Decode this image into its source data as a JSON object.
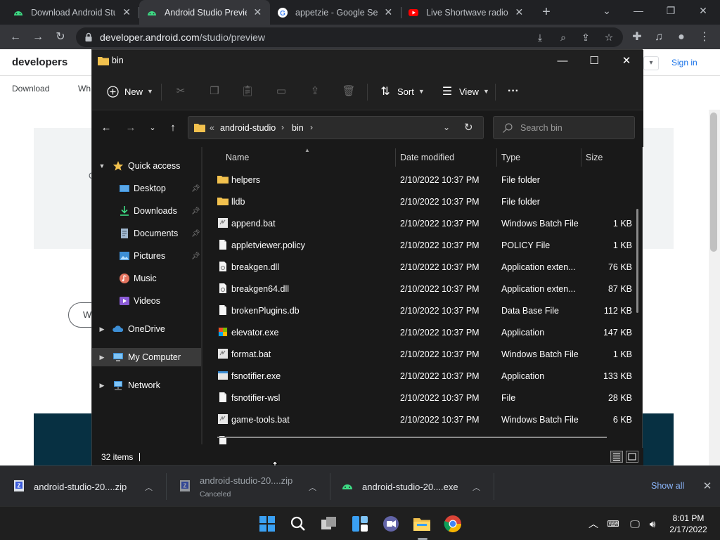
{
  "browser": {
    "tabs": [
      {
        "title": "Download Android Stu",
        "icon": "android-icon",
        "active": false
      },
      {
        "title": "Android Studio Preview",
        "icon": "android-icon",
        "active": true
      },
      {
        "title": "appetzie - Google Sea",
        "icon": "google-icon",
        "active": false
      },
      {
        "title": "Live Shortwave radio s",
        "icon": "youtube-icon",
        "active": false
      }
    ],
    "url_host": "developer.android.com",
    "url_path": "/studio/preview"
  },
  "webpage": {
    "logo": "developers",
    "nav_download": "Download",
    "nav_partial": "Wh",
    "signin": "Sign in",
    "pill_text": "W",
    "side_c": "C"
  },
  "explorer": {
    "title": "bin",
    "commands": {
      "new": "New",
      "sort": "Sort",
      "view": "View",
      "more": "···"
    },
    "path": {
      "overflow": "«",
      "segments": [
        "android-studio",
        "bin"
      ]
    },
    "search_placeholder": "Search bin",
    "sidebar": {
      "quick_access": "Quick access",
      "items": [
        {
          "label": "Desktop",
          "pinned": true
        },
        {
          "label": "Downloads",
          "pinned": true
        },
        {
          "label": "Documents",
          "pinned": true
        },
        {
          "label": "Pictures",
          "pinned": true
        },
        {
          "label": "Music",
          "pinned": false
        },
        {
          "label": "Videos",
          "pinned": false
        }
      ],
      "onedrive": "OneDrive",
      "my_computer": "My Computer",
      "network": "Network"
    },
    "columns": {
      "name": "Name",
      "date": "Date modified",
      "type": "Type",
      "size": "Size"
    },
    "files": [
      {
        "name": "helpers",
        "date": "2/10/2022 10:37 PM",
        "type": "File folder",
        "size": "",
        "icon": "folder"
      },
      {
        "name": "lldb",
        "date": "2/10/2022 10:37 PM",
        "type": "File folder",
        "size": "",
        "icon": "folder"
      },
      {
        "name": "append.bat",
        "date": "2/10/2022 10:37 PM",
        "type": "Windows Batch File",
        "size": "1 KB",
        "icon": "bat"
      },
      {
        "name": "appletviewer.policy",
        "date": "2/10/2022 10:37 PM",
        "type": "POLICY File",
        "size": "1 KB",
        "icon": "file"
      },
      {
        "name": "breakgen.dll",
        "date": "2/10/2022 10:37 PM",
        "type": "Application exten...",
        "size": "76 KB",
        "icon": "dll"
      },
      {
        "name": "breakgen64.dll",
        "date": "2/10/2022 10:37 PM",
        "type": "Application exten...",
        "size": "87 KB",
        "icon": "dll"
      },
      {
        "name": "brokenPlugins.db",
        "date": "2/10/2022 10:37 PM",
        "type": "Data Base File",
        "size": "112 KB",
        "icon": "file"
      },
      {
        "name": "elevator.exe",
        "date": "2/10/2022 10:37 PM",
        "type": "Application",
        "size": "147 KB",
        "icon": "exe-color"
      },
      {
        "name": "format.bat",
        "date": "2/10/2022 10:37 PM",
        "type": "Windows Batch File",
        "size": "1 KB",
        "icon": "bat"
      },
      {
        "name": "fsnotifier.exe",
        "date": "2/10/2022 10:37 PM",
        "type": "Application",
        "size": "133 KB",
        "icon": "exe"
      },
      {
        "name": "fsnotifier-wsl",
        "date": "2/10/2022 10:37 PM",
        "type": "File",
        "size": "28 KB",
        "icon": "file"
      },
      {
        "name": "game-tools.bat",
        "date": "2/10/2022 10:37 PM",
        "type": "Windows Batch File",
        "size": "6 KB",
        "icon": "bat"
      }
    ],
    "status": "32 items"
  },
  "downloads": {
    "items": [
      {
        "name": "android-studio-20....zip",
        "sub": ""
      },
      {
        "name": "android-studio-20....zip",
        "sub": "Canceled"
      },
      {
        "name": "android-studio-20....exe",
        "sub": ""
      }
    ],
    "show_all": "Show all"
  },
  "taskbar": {
    "time": "8:01 PM",
    "date": "2/17/2022"
  },
  "colors": {
    "folder": "#f2c14e",
    "accent_link": "#8ab4f8",
    "explorer_bg": "#191919"
  }
}
